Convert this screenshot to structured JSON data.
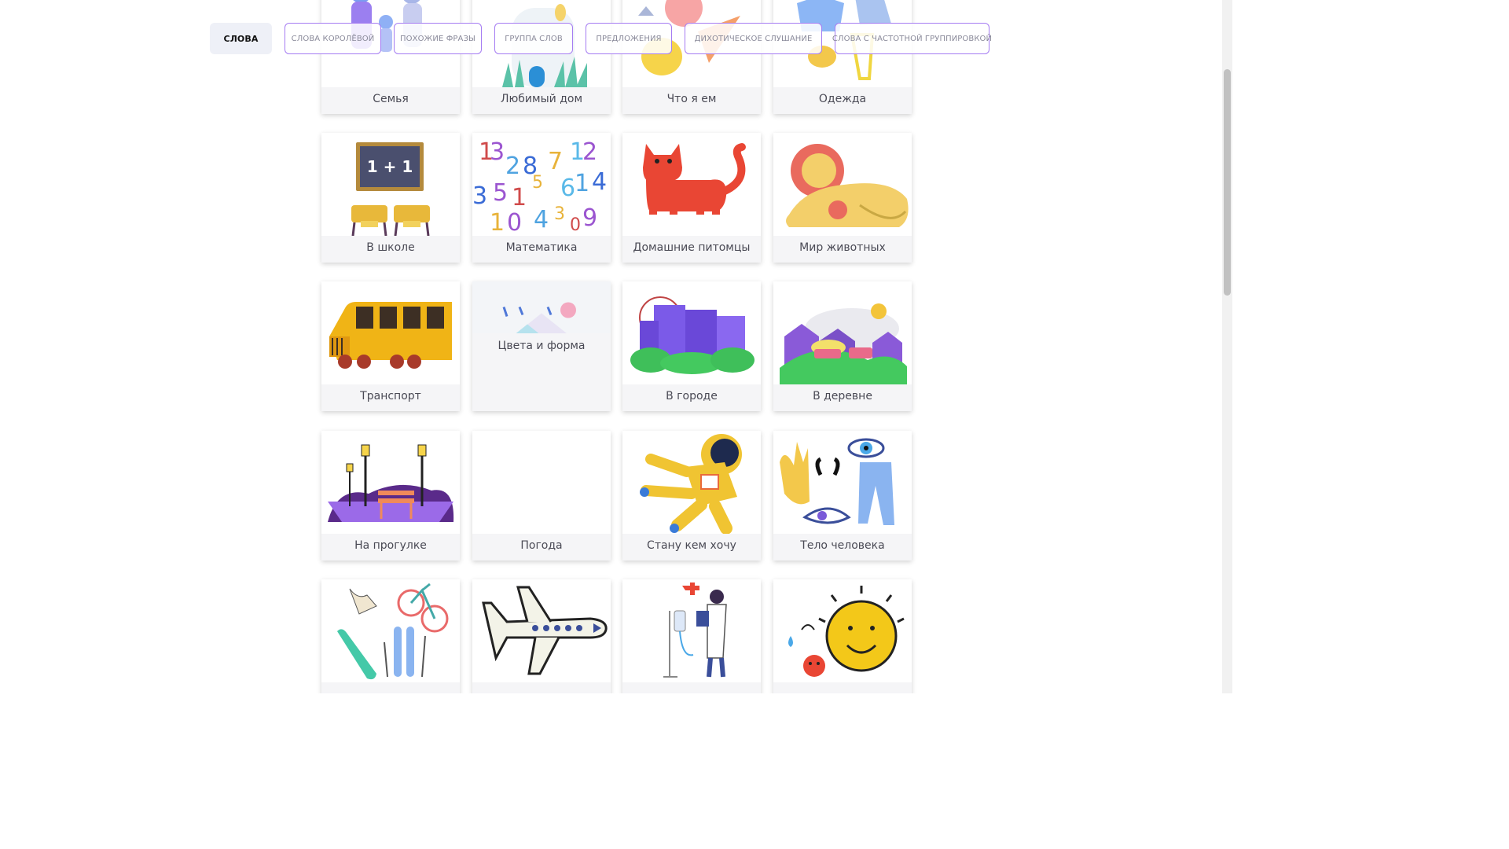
{
  "tabs": [
    {
      "label": "СЛОВА",
      "active": true
    },
    {
      "label": "СЛОВА КОРОЛЁВОЙ"
    },
    {
      "label": "ПОХОЖИЕ ФРАЗЫ"
    },
    {
      "label": "ГРУППА СЛОВ"
    },
    {
      "label": "ПРЕДЛОЖЕНИЯ"
    },
    {
      "label": "ДИХОТИЧЕСКОЕ СЛУШАНИЕ"
    },
    {
      "label": "СЛОВА С ЧАСТОТНОЙ ГРУППИРОВКОЙ"
    }
  ],
  "categories": [
    {
      "label": "Семья",
      "icon": "family-icon"
    },
    {
      "label": "Любимый дом",
      "icon": "house-icon"
    },
    {
      "label": "Что я ем",
      "icon": "food-icon"
    },
    {
      "label": "Одежда",
      "icon": "clothes-icon"
    },
    {
      "label": "В школе",
      "icon": "school-icon"
    },
    {
      "label": "Математика",
      "icon": "numbers-icon"
    },
    {
      "label": "Домашние питомцы",
      "icon": "cat-icon"
    },
    {
      "label": "Мир животных",
      "icon": "lion-icon"
    },
    {
      "label": "Транспорт",
      "icon": "bus-icon"
    },
    {
      "label": "Цвета и форма",
      "icon": "shapes-icon"
    },
    {
      "label": "В городе",
      "icon": "city-icon"
    },
    {
      "label": "В деревне",
      "icon": "village-icon"
    },
    {
      "label": "На прогулке",
      "icon": "park-icon"
    },
    {
      "label": "Погода",
      "icon": "weather-icon"
    },
    {
      "label": "Стану кем хочу",
      "icon": "astronaut-icon"
    },
    {
      "label": "Тело человека",
      "icon": "body-icon"
    },
    {
      "label": "",
      "icon": "sports-icon"
    },
    {
      "label": "",
      "icon": "airplane-icon"
    },
    {
      "label": "",
      "icon": "doctor-icon"
    },
    {
      "label": "",
      "icon": "emotions-icon"
    }
  ],
  "colors": {
    "accent": "#a57cf2",
    "active_tab_bg": "#eef0f7"
  }
}
